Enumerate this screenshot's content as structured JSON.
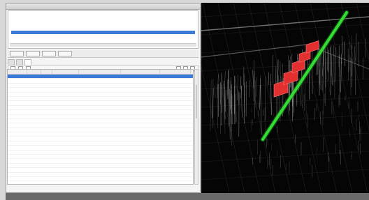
{
  "window": {
    "title": ""
  },
  "upper_panel": {
    "path": "",
    "info_lines": [
      "",
      ""
    ],
    "columns": [
      "",
      "",
      "",
      "",
      "",
      ""
    ],
    "selected_row": [
      "",
      "",
      "",
      "",
      "",
      ""
    ]
  },
  "toolbar": {
    "buttons": [
      "",
      "",
      "",
      ""
    ]
  },
  "tabs": [
    {
      "label": ""
    },
    {
      "label": ""
    },
    {
      "label": ""
    }
  ],
  "grid": {
    "columns": [
      "",
      "",
      "",
      "",
      "",
      "",
      ""
    ],
    "rows": [
      [
        "",
        "",
        "",
        "",
        "",
        "",
        ""
      ],
      [
        "",
        "",
        "",
        "",
        "",
        "",
        ""
      ],
      [
        "",
        "",
        "",
        "",
        "",
        "",
        ""
      ],
      [
        "",
        "",
        "",
        "",
        "",
        "",
        ""
      ],
      [
        "",
        "",
        "",
        "",
        "",
        "",
        ""
      ],
      [
        "",
        "",
        "",
        "",
        "",
        "",
        ""
      ],
      [
        "",
        "",
        "",
        "",
        "",
        "",
        ""
      ],
      [
        "",
        "",
        "",
        "",
        "",
        "",
        ""
      ],
      [
        "",
        "",
        "",
        "",
        "",
        "",
        ""
      ],
      [
        "",
        "",
        "",
        "",
        "",
        "",
        ""
      ],
      [
        "",
        "",
        "",
        "",
        "",
        "",
        ""
      ],
      [
        "",
        "",
        "",
        "",
        "",
        "",
        ""
      ],
      [
        "",
        "",
        "",
        "",
        "",
        "",
        ""
      ],
      [
        "",
        "",
        "",
        "",
        "",
        "",
        ""
      ],
      [
        "",
        "",
        "",
        "",
        "",
        "",
        ""
      ],
      [
        "",
        "",
        "",
        "",
        "",
        "",
        ""
      ],
      [
        "",
        "",
        "",
        "",
        "",
        "",
        ""
      ],
      [
        "",
        "",
        "",
        "",
        "",
        "",
        ""
      ],
      [
        "",
        "",
        "",
        "",
        "",
        "",
        ""
      ],
      [
        "",
        "",
        "",
        "",
        "",
        "",
        ""
      ],
      [
        "",
        "",
        "",
        "",
        "",
        "",
        ""
      ],
      [
        "",
        "",
        "",
        "",
        "",
        "",
        ""
      ],
      [
        "",
        "",
        "",
        "",
        "",
        "",
        ""
      ],
      [
        "",
        "",
        "",
        "",
        "",
        "",
        ""
      ],
      [
        "",
        "",
        "",
        "",
        "",
        "",
        ""
      ],
      [
        "",
        "",
        "",
        "",
        "",
        "",
        ""
      ],
      [
        "",
        "",
        "",
        "",
        "",
        "",
        ""
      ],
      [
        "",
        "",
        "",
        "",
        "",
        "",
        ""
      ],
      [
        "",
        "",
        "",
        "",
        "",
        "",
        ""
      ]
    ],
    "selected_index": 0
  },
  "status": {
    "text": ""
  },
  "viewport": {
    "background": "#050505",
    "track_color": "#33dd33",
    "highlight_color": "#e23030"
  }
}
